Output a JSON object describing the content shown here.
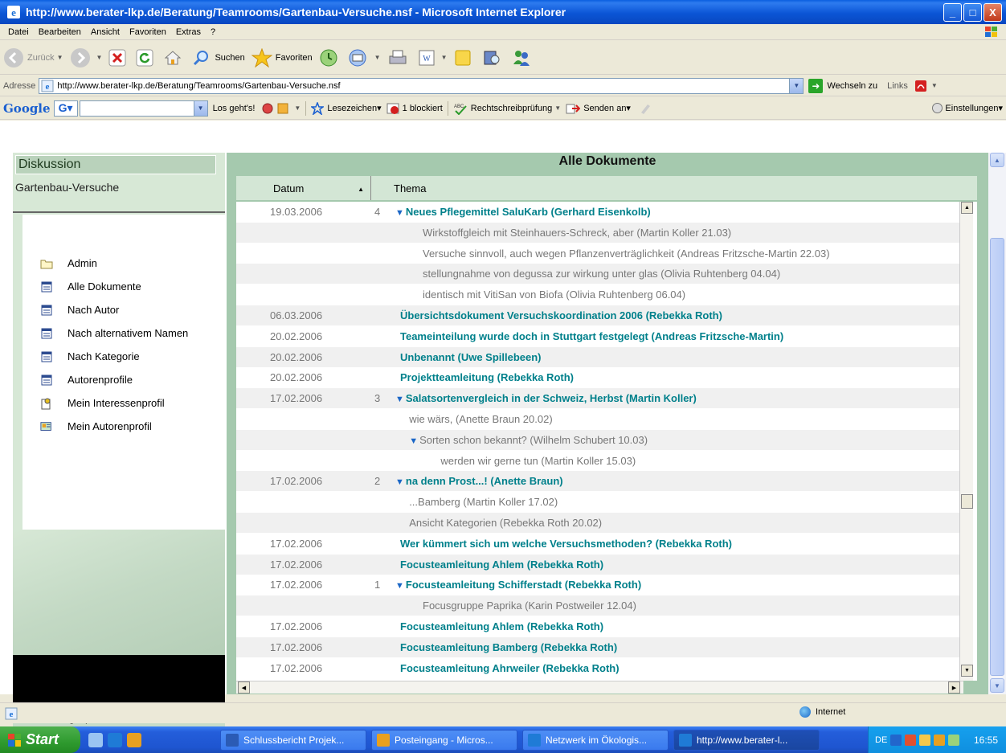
{
  "window": {
    "title": "http://www.berater-lkp.de/Beratung/Teamrooms/Gartenbau-Versuche.nsf - Microsoft Internet Explorer",
    "min_glyph": "_",
    "max_glyph": "□",
    "close_glyph": "X"
  },
  "menu": [
    "Datei",
    "Bearbeiten",
    "Ansicht",
    "Favoriten",
    "Extras",
    "?"
  ],
  "toolbar": {
    "back": "Zurück",
    "search": "Suchen",
    "favorites": "Favoriten"
  },
  "address": {
    "label": "Adresse",
    "url": "http://www.berater-lkp.de/Beratung/Teamrooms/Gartenbau-Versuche.nsf",
    "go": "Wechseln zu",
    "links": "Links"
  },
  "google": {
    "logo": "Google",
    "g": "G▾",
    "go": "Los geht's!",
    "bookmarks": "Lesezeichen▾",
    "blocked": "1 blockiert",
    "spell": "Rechtschreibprüfung",
    "send": "Senden an▾",
    "settings": "Einstellungen▾"
  },
  "sidebar": {
    "title": "Diskussion",
    "db": "Gartenbau-Versuche",
    "nav": [
      {
        "label": "Admin",
        "icon": "folder-icon"
      },
      {
        "label": "Alle Dokumente",
        "icon": "view-icon"
      },
      {
        "label": "Nach Autor",
        "icon": "view-icon"
      },
      {
        "label": "Nach alternativem Namen",
        "icon": "view-icon"
      },
      {
        "label": "Nach Kategorie",
        "icon": "view-icon"
      },
      {
        "label": "Autorenprofile",
        "icon": "view-icon"
      },
      {
        "label": "Mein Interessenprofil",
        "icon": "profile-icon"
      },
      {
        "label": "Mein Autorenprofil",
        "icon": "author-profile-icon"
      }
    ],
    "footer": "auf beratung/lkp"
  },
  "view": {
    "title": "Alle Dokumente",
    "col_date": "Datum",
    "col_topic": "Thema",
    "rows": [
      {
        "date": "19.03.2006",
        "count": "4",
        "level": 0,
        "type": "main",
        "twisty": true,
        "text": "Neues Pflegemittel SaluKarb (Gerhard Eisenkolb)"
      },
      {
        "date": "",
        "count": "",
        "level": 2,
        "type": "resp",
        "twisty": false,
        "text": "Wirkstoffgleich mit Steinhauers-Schreck, aber  (Martin Koller 21.03)"
      },
      {
        "date": "",
        "count": "",
        "level": 2,
        "type": "resp",
        "twisty": false,
        "text": "Versuche sinnvoll, auch wegen Pflanzenverträglichkeit  (Andreas Fritzsche-Martin 22.03)"
      },
      {
        "date": "",
        "count": "",
        "level": 2,
        "type": "resp",
        "twisty": false,
        "text": "stellungnahme von degussa zur wirkung unter glas  (Olivia Ruhtenberg 04.04)"
      },
      {
        "date": "",
        "count": "",
        "level": 2,
        "type": "resp",
        "twisty": false,
        "text": "identisch mit VitiSan von Biofa  (Olivia Ruhtenberg 06.04)"
      },
      {
        "date": "06.03.2006",
        "count": "",
        "level": 1,
        "type": "main",
        "twisty": false,
        "text": "Übersichtsdokument Versuchskoordination 2006 (Rebekka Roth)"
      },
      {
        "date": "20.02.2006",
        "count": "",
        "level": 1,
        "type": "main",
        "twisty": false,
        "text": "Teameinteilung wurde doch in Stuttgart festgelegt (Andreas Fritzsche-Martin)"
      },
      {
        "date": "20.02.2006",
        "count": "",
        "level": 1,
        "type": "main",
        "twisty": false,
        "text": "Unbenannt (Uwe Spillebeen)"
      },
      {
        "date": "20.02.2006",
        "count": "",
        "level": 1,
        "type": "main",
        "twisty": false,
        "text": "Projektteamleitung (Rebekka Roth)"
      },
      {
        "date": "17.02.2006",
        "count": "3",
        "level": 0,
        "type": "main",
        "twisty": true,
        "text": "Salatsortenvergleich in der Schweiz, Herbst (Martin Koller)"
      },
      {
        "date": "",
        "count": "",
        "level": 1.4,
        "type": "resp",
        "twisty": false,
        "text": "wie wärs,  (Anette Braun 20.02)"
      },
      {
        "date": "",
        "count": "",
        "level": 1.4,
        "type": "resp",
        "twisty": true,
        "text": "Sorten schon bekannt?  (Wilhelm Schubert 10.03)"
      },
      {
        "date": "",
        "count": "",
        "level": 2.8,
        "type": "resp",
        "twisty": false,
        "text": "werden wir gerne tun  (Martin Koller 15.03)"
      },
      {
        "date": "17.02.2006",
        "count": "2",
        "level": 0,
        "type": "main",
        "twisty": true,
        "text": "na denn Prost...! (Anette Braun)"
      },
      {
        "date": "",
        "count": "",
        "level": 1.4,
        "type": "resp",
        "twisty": false,
        "text": "...Bamberg  (Martin Koller 17.02)"
      },
      {
        "date": "",
        "count": "",
        "level": 1.4,
        "type": "resp",
        "twisty": false,
        "text": "Ansicht Kategorien  (Rebekka Roth 20.02)"
      },
      {
        "date": "17.02.2006",
        "count": "",
        "level": 1,
        "type": "main",
        "twisty": false,
        "text": "Wer kümmert sich um welche Versuchsmethoden? (Rebekka Roth)"
      },
      {
        "date": "17.02.2006",
        "count": "",
        "level": 1,
        "type": "main",
        "twisty": false,
        "text": "Focusteamleitung Ahlem (Rebekka Roth)"
      },
      {
        "date": "17.02.2006",
        "count": "1",
        "level": 0,
        "type": "main",
        "twisty": true,
        "text": "Focusteamleitung Schifferstadt (Rebekka Roth)"
      },
      {
        "date": "",
        "count": "",
        "level": 2,
        "type": "resp",
        "twisty": false,
        "text": "Focusgruppe Paprika  (Karin Postweiler 12.04)"
      },
      {
        "date": "17.02.2006",
        "count": "",
        "level": 1,
        "type": "main",
        "twisty": false,
        "text": "Focusteamleitung Ahlem (Rebekka Roth)"
      },
      {
        "date": "17.02.2006",
        "count": "",
        "level": 1,
        "type": "main",
        "twisty": false,
        "text": "Focusteamleitung Bamberg (Rebekka Roth)"
      },
      {
        "date": "17.02.2006",
        "count": "",
        "level": 1,
        "type": "main",
        "twisty": false,
        "text": "Focusteamleitung Ahrweiler (Rebekka Roth)"
      }
    ]
  },
  "status": {
    "zone": "Internet"
  },
  "taskbar": {
    "start": "Start",
    "tasks": [
      {
        "label": "Schlussbericht Projek...",
        "icon": "word-icon",
        "color": "#2B5BB5"
      },
      {
        "label": "Posteingang - Micros...",
        "icon": "outlook-icon",
        "color": "#E8A020"
      },
      {
        "label": "Netzwerk im Ökologis...",
        "icon": "ie-icon",
        "color": "#1F7BD6"
      },
      {
        "label": "http://www.berater-l...",
        "icon": "ie-icon",
        "color": "#1F7BD6"
      }
    ],
    "lang": "DE",
    "clock": "16:55"
  },
  "colors": {
    "accent_teal": "#00808B",
    "panel_green": "#A5C9AE",
    "header_green": "#D3E6D5"
  }
}
